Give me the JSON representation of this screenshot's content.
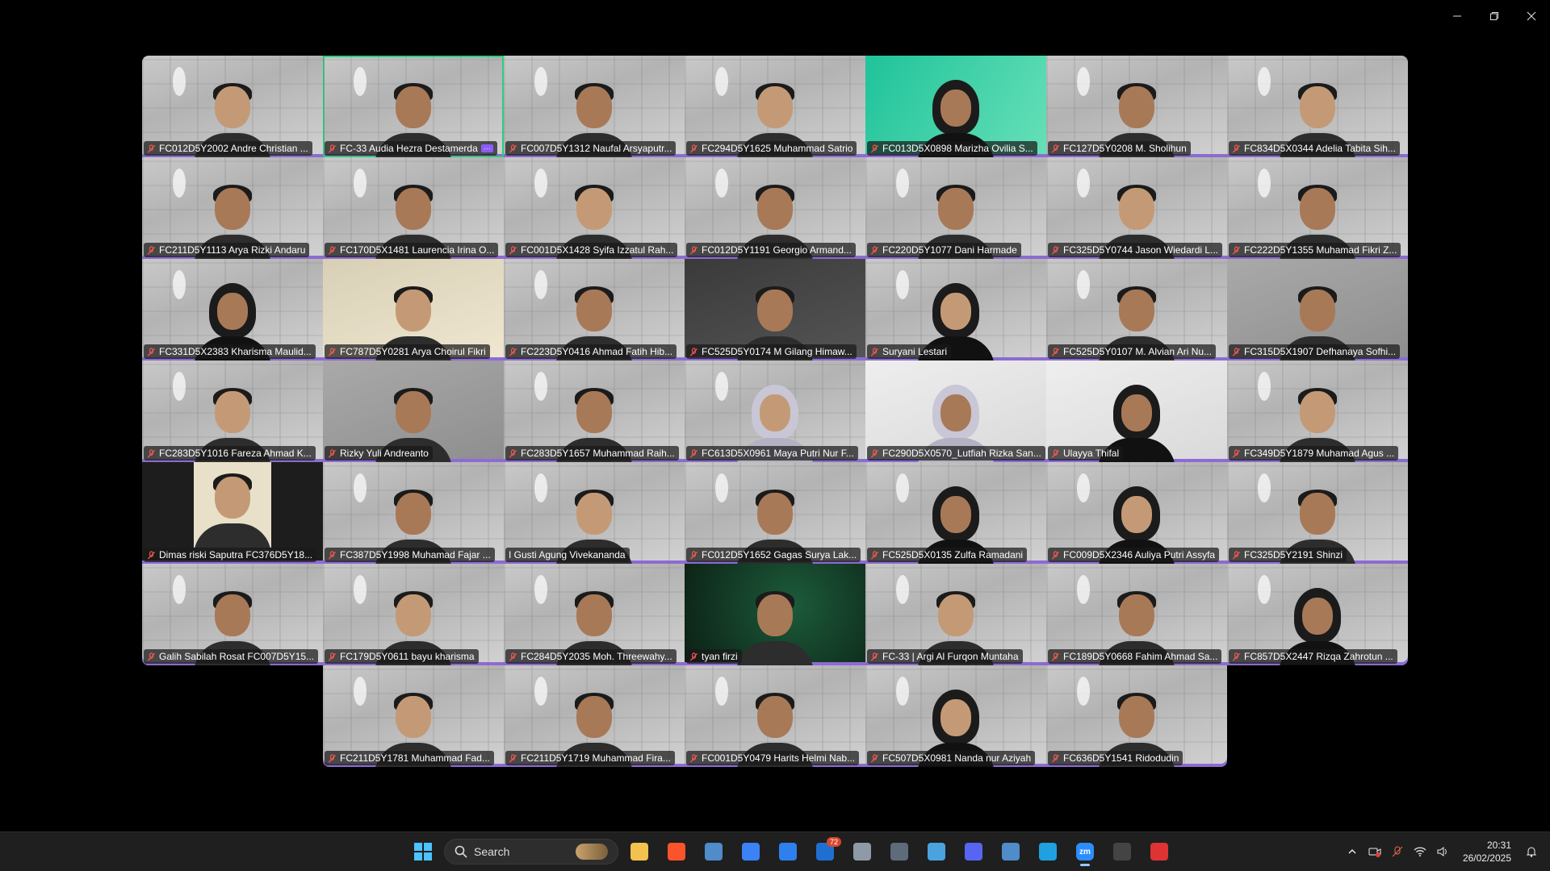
{
  "window": {
    "controls": {
      "minimize": "minimize",
      "maximize": "maximize",
      "close": "close"
    }
  },
  "gallery": {
    "rows": [
      [
        {
          "name": "FC012D5Y2002 Andre Christian ...",
          "bg": "pattern",
          "muted": true
        },
        {
          "name": "FC-33 Audia Hezra Destamerda",
          "bg": "pattern",
          "muted": true,
          "active": true,
          "badge": "···"
        },
        {
          "name": "FC007D5Y1312 Naufal Arsyaputr...",
          "bg": "pattern",
          "muted": true
        },
        {
          "name": "FC294D5Y1625 Muhammad Satrio",
          "bg": "pattern",
          "muted": true
        },
        {
          "name": "FC013D5X0898 Marizha Ovilia S...",
          "bg": "green",
          "muted": true,
          "person": "hijab"
        },
        {
          "name": "FC127D5Y0208 M. Sholihun",
          "bg": "pattern",
          "muted": true
        },
        {
          "name": "FC834D5X0344 Adelia Tabita Sih...",
          "bg": "pattern",
          "muted": true
        }
      ],
      [
        {
          "name": "FC211D5Y1113 Arya Rizki Andaru",
          "bg": "pattern",
          "muted": true
        },
        {
          "name": "FC170D5X1481 Laurencia Irina O...",
          "bg": "pattern",
          "muted": true
        },
        {
          "name": "FC001D5X1428 Syifa Izzatul Rah...",
          "bg": "pattern",
          "muted": true
        },
        {
          "name": "FC012D5Y1191 Georgio Armand...",
          "bg": "pattern",
          "muted": true
        },
        {
          "name": "FC220D5Y1077 Dani Harmade",
          "bg": "pattern",
          "muted": true
        },
        {
          "name": "FC325D5Y0744 Jason Wiedardi L...",
          "bg": "pattern",
          "muted": true
        },
        {
          "name": "FC222D5Y1355 Muhamad Fikri Z...",
          "bg": "pattern",
          "muted": true
        }
      ],
      [
        {
          "name": "FC331D5X2383 Kharisma Maulid...",
          "bg": "pattern",
          "muted": true,
          "person": "hijab"
        },
        {
          "name": "FC787D5Y0281 Arya Choirul Fikri",
          "bg": "beige",
          "muted": true
        },
        {
          "name": "FC223D5Y0416 Ahmad Fatih Hib...",
          "bg": "pattern",
          "muted": true
        },
        {
          "name": "FC525D5Y0174 M Gilang Himaw...",
          "bg": "dark",
          "muted": true
        },
        {
          "name": "Suryani Lestari",
          "bg": "pattern",
          "muted": true,
          "person": "hijab"
        },
        {
          "name": "FC525D5Y0107 M. Alvian Ari Nu...",
          "bg": "pattern",
          "muted": true
        },
        {
          "name": "FC315D5X1907 Defhanaya Sofhi...",
          "bg": "grey",
          "muted": true
        }
      ],
      [
        {
          "name": "FC283D5Y1016 Fareza Ahmad K...",
          "bg": "pattern",
          "muted": true
        },
        {
          "name": "Rizky Yuli Andreanto",
          "bg": "grey",
          "muted": true
        },
        {
          "name": "FC283D5Y1657 Muhammad Raih...",
          "bg": "pattern",
          "muted": true
        },
        {
          "name": "FC613D5X0961 Maya Putri Nur F...",
          "bg": "pattern",
          "muted": true,
          "person": "hijab-white"
        },
        {
          "name": "FC290D5X0570_Lutfiah Rizka San...",
          "bg": "white",
          "muted": true,
          "person": "hijab-white"
        },
        {
          "name": "Ulayya Thifal",
          "bg": "white",
          "muted": true,
          "person": "hijab"
        },
        {
          "name": "FC349D5Y1879 Muhamad Agus ...",
          "bg": "pattern",
          "muted": true
        }
      ],
      [
        {
          "name": "Dimas riski Saputra FC376D5Y18...",
          "bg": "black",
          "muted": true,
          "person": "portrait"
        },
        {
          "name": "FC387D5Y1998 Muhamad Fajar ...",
          "bg": "pattern",
          "muted": true
        },
        {
          "name": "I Gusti Agung Vivekananda",
          "bg": "pattern",
          "muted": false
        },
        {
          "name": "FC012D5Y1652 Gagas Surya Lak...",
          "bg": "pattern",
          "muted": true
        },
        {
          "name": "FC525D5X0135 Zulfa Ramadani",
          "bg": "pattern",
          "muted": true,
          "person": "hijab"
        },
        {
          "name": "FC009D5X2346 Auliya Putri Assyfa",
          "bg": "pattern",
          "muted": true,
          "person": "hijab"
        },
        {
          "name": "FC325D5Y2191 Shinzi",
          "bg": "pattern",
          "muted": true
        }
      ],
      [
        {
          "name": "Galih Sabilah Rosat FC007D5Y15...",
          "bg": "pattern",
          "muted": true
        },
        {
          "name": "FC179D5Y0611 bayu kharisma",
          "bg": "pattern",
          "muted": true
        },
        {
          "name": "FC284D5Y2035 Moh. Threewahy...",
          "bg": "pattern",
          "muted": true
        },
        {
          "name": "tyan firzi",
          "bg": "darkgreen",
          "muted": true
        },
        {
          "name": "FC-33 | Argi Al Furqon Muntaha",
          "bg": "pattern",
          "muted": true
        },
        {
          "name": "FC189D5Y0668 Fahim Ahmad Sa...",
          "bg": "pattern",
          "muted": true
        },
        {
          "name": "FC857D5X2447 Rizqa Zahrotun ...",
          "bg": "pattern",
          "muted": true,
          "person": "hijab"
        }
      ],
      [
        {
          "name": "FC211D5Y1781 Muhammad Fad...",
          "bg": "pattern",
          "muted": true
        },
        {
          "name": "FC211D5Y1719 Muhammad Fira...",
          "bg": "pattern",
          "muted": true
        },
        {
          "name": "FC001D5Y0479 Harits Helmi Nab...",
          "bg": "pattern",
          "muted": true
        },
        {
          "name": "FC507D5X0981 Nanda nur Aziyah",
          "bg": "pattern",
          "muted": true,
          "person": "hijab"
        },
        {
          "name": "FC636D5Y1541 Ridodudin",
          "bg": "pattern",
          "muted": true
        }
      ]
    ]
  },
  "taskbar": {
    "search_label": "Search",
    "apps": [
      {
        "icon": "file-explorer-icon",
        "color": "#f2c14e"
      },
      {
        "icon": "brave-browser-icon",
        "color": "#fb542b"
      },
      {
        "icon": "steam-icon",
        "color": "#4f8cc9"
      },
      {
        "icon": "todo-check-icon",
        "color": "#3b82f6"
      },
      {
        "icon": "vscode-icon",
        "color": "#2f80ed"
      },
      {
        "icon": "outlook-icon",
        "color": "#1f6fd1",
        "badge": "72"
      },
      {
        "icon": "settings-icon",
        "color": "#8e9aa6"
      },
      {
        "icon": "calculator-icon",
        "color": "#5d6b7a"
      },
      {
        "icon": "notepad-icon",
        "color": "#4aa3df"
      },
      {
        "icon": "discord-icon",
        "color": "#5865f2"
      },
      {
        "icon": "steam-icon",
        "color": "#4f8cc9"
      },
      {
        "icon": "edge-icon",
        "color": "#1fa0e0"
      },
      {
        "icon": "zoom-icon",
        "color": "#2d8cff",
        "active": true,
        "label": "zm"
      },
      {
        "icon": "terminal-icon",
        "color": "#444"
      },
      {
        "icon": "snipping-tool-icon",
        "color": "#d33"
      }
    ],
    "clock": {
      "time": "20:31",
      "date": "26/02/2025"
    }
  }
}
